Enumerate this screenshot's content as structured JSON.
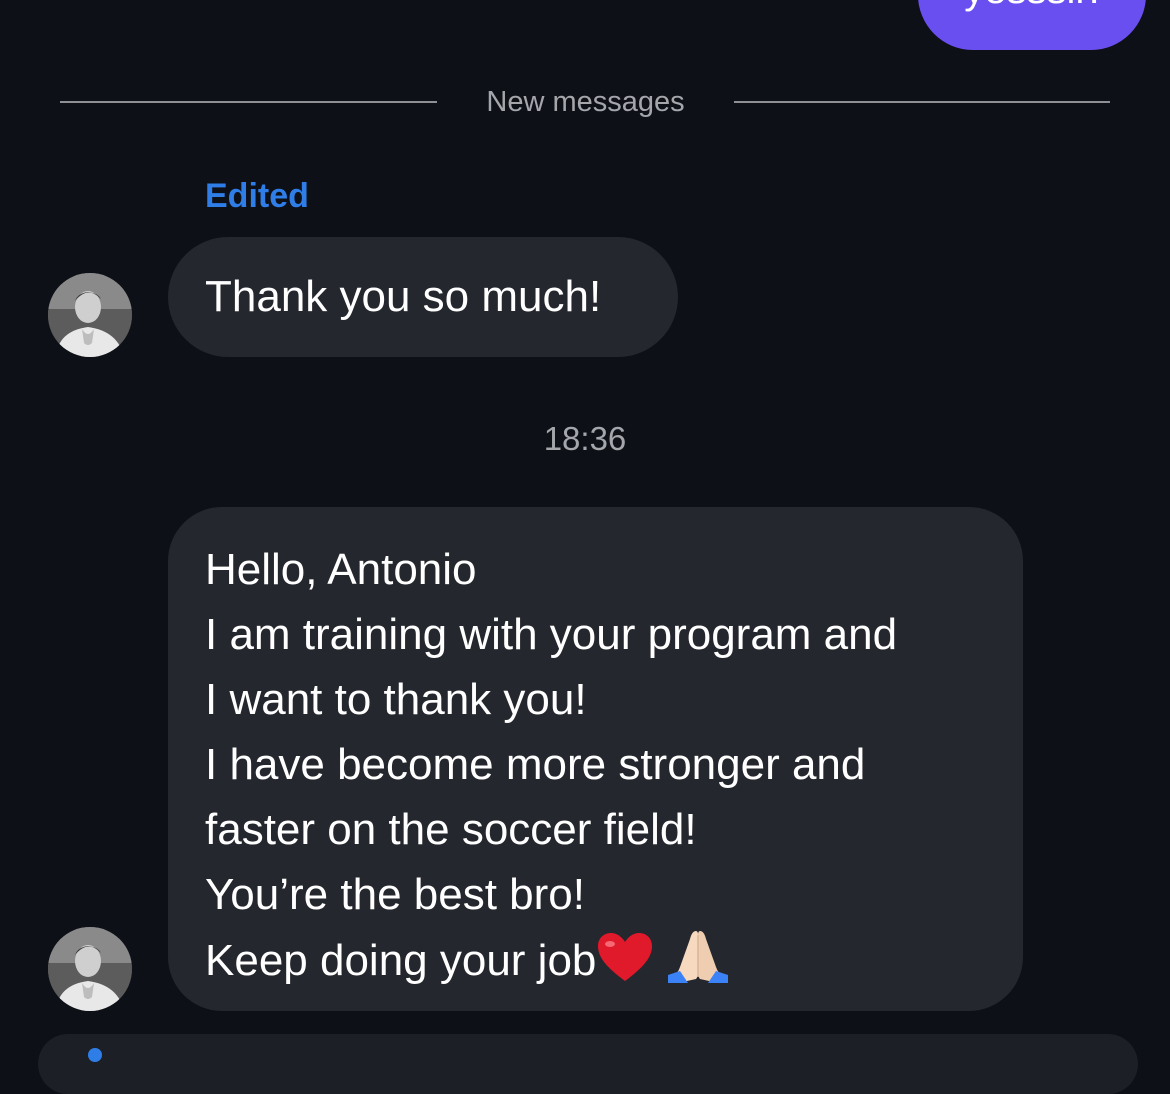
{
  "sent_message": {
    "text": "yesssir!"
  },
  "divider": {
    "label": "New messages"
  },
  "first_message": {
    "edited_label": "Edited",
    "text": "Thank you so much!"
  },
  "timestamp": "18:36",
  "second_message": {
    "lines": [
      "Hello, Antonio",
      "I am training with your program and",
      "I want to thank you!",
      "I have become more stronger and",
      "faster on the soccer field!",
      "You’re the best bro!",
      "Keep doing your job"
    ],
    "trailing_emojis": [
      "red-heart-icon",
      "folded-hands-icon"
    ]
  },
  "colors": {
    "background": "#0d1017",
    "sent_bubble": "#6a4ff0",
    "received_bubble": "#24272d",
    "edited_accent": "#2f7ee8",
    "muted_text": "#a4a6ab"
  }
}
